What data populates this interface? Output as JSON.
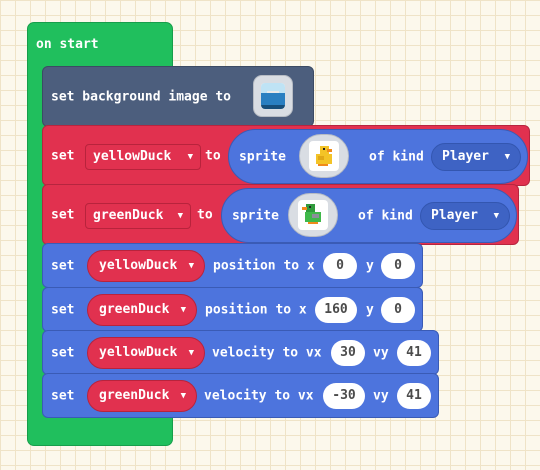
{
  "on_start": {
    "label": "on start"
  },
  "set_background": {
    "label": "set background image to",
    "icon": "background-image-thumbnail"
  },
  "create_yellow": {
    "set": "set",
    "var": "yellowDuck",
    "to": "to",
    "sprite": "sprite",
    "of_kind": "of kind",
    "kind": "Player",
    "icon": "yellow-duck-sprite"
  },
  "create_green": {
    "set": "set",
    "var": "greenDuck",
    "to": "to",
    "sprite": "sprite",
    "of_kind": "of kind",
    "kind": "Player",
    "icon": "green-duck-sprite"
  },
  "pos_yellow": {
    "set": "set",
    "var": "yellowDuck",
    "label": "position to x",
    "x": "0",
    "y_label": "y",
    "y": "0"
  },
  "pos_green": {
    "set": "set",
    "var": "greenDuck",
    "label": "position to x",
    "x": "160",
    "y_label": "y",
    "y": "0"
  },
  "vel_yellow": {
    "set": "set",
    "var": "yellowDuck",
    "label": "velocity to vx",
    "vx": "30",
    "vy_label": "vy",
    "vy": "41"
  },
  "vel_green": {
    "set": "set",
    "var": "greenDuck",
    "label": "velocity to vx",
    "vx": "-30",
    "vy_label": "vy",
    "vy": "41"
  },
  "colors": {
    "events": "#20bf5d",
    "scene": "#4c5e7d",
    "sprites": "#e1314f",
    "sprite_blue": "#4d74dd"
  }
}
